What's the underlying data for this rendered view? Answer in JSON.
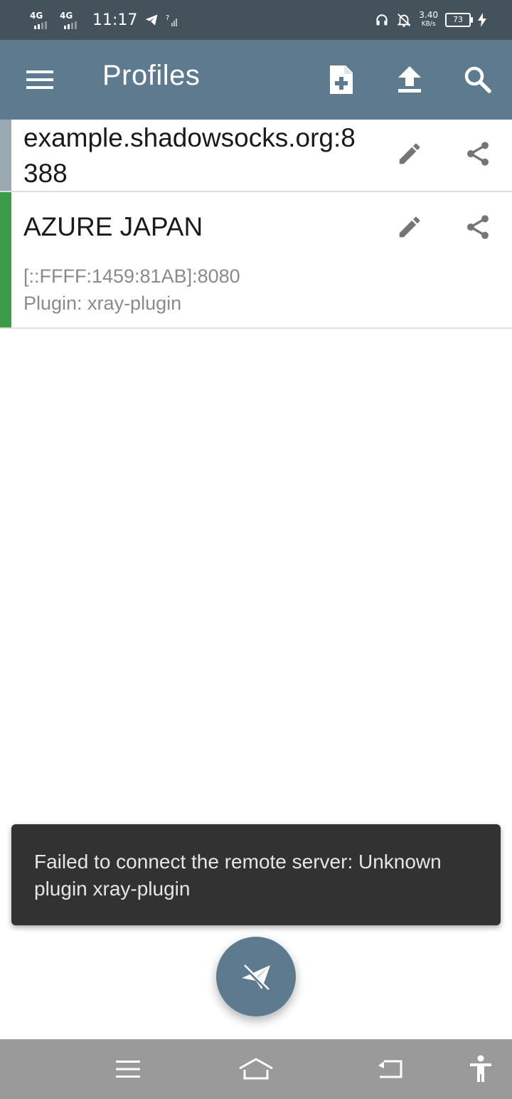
{
  "status_bar": {
    "network_1": "4G",
    "network_2": "4G",
    "time": "11:17",
    "speed_value": "3.40",
    "speed_unit": "KB/s",
    "battery_level": "73"
  },
  "toolbar": {
    "title": "Profiles",
    "icons": [
      "menu-icon",
      "add-file-icon",
      "upload-icon",
      "search-icon"
    ]
  },
  "profiles": [
    {
      "name": "example.shadowsocks.org:8388",
      "name_line1": "example.shadowsocks.org:8",
      "name_line2": "388",
      "stripe_color": "#9aa9b2"
    },
    {
      "name": "AZURE JAPAN",
      "address": "[::FFFF:1459:81AB]:8080",
      "plugin": "Plugin: xray-plugin",
      "stripe_color": "#3c9a48"
    }
  ],
  "snackbar": {
    "message": "Failed to connect the remote server: Unknown plugin xray-plugin"
  },
  "fab": {
    "icon": "paper-plane-disconnected-icon"
  },
  "navbar": {
    "icons": [
      "recents-icon",
      "home-icon",
      "back-icon",
      "accessibility-icon"
    ]
  },
  "colors": {
    "primary": "#5e7a8f",
    "status_bar": "#44525c",
    "snackbar_bg": "#323232",
    "active_profile": "#3c9a48"
  }
}
